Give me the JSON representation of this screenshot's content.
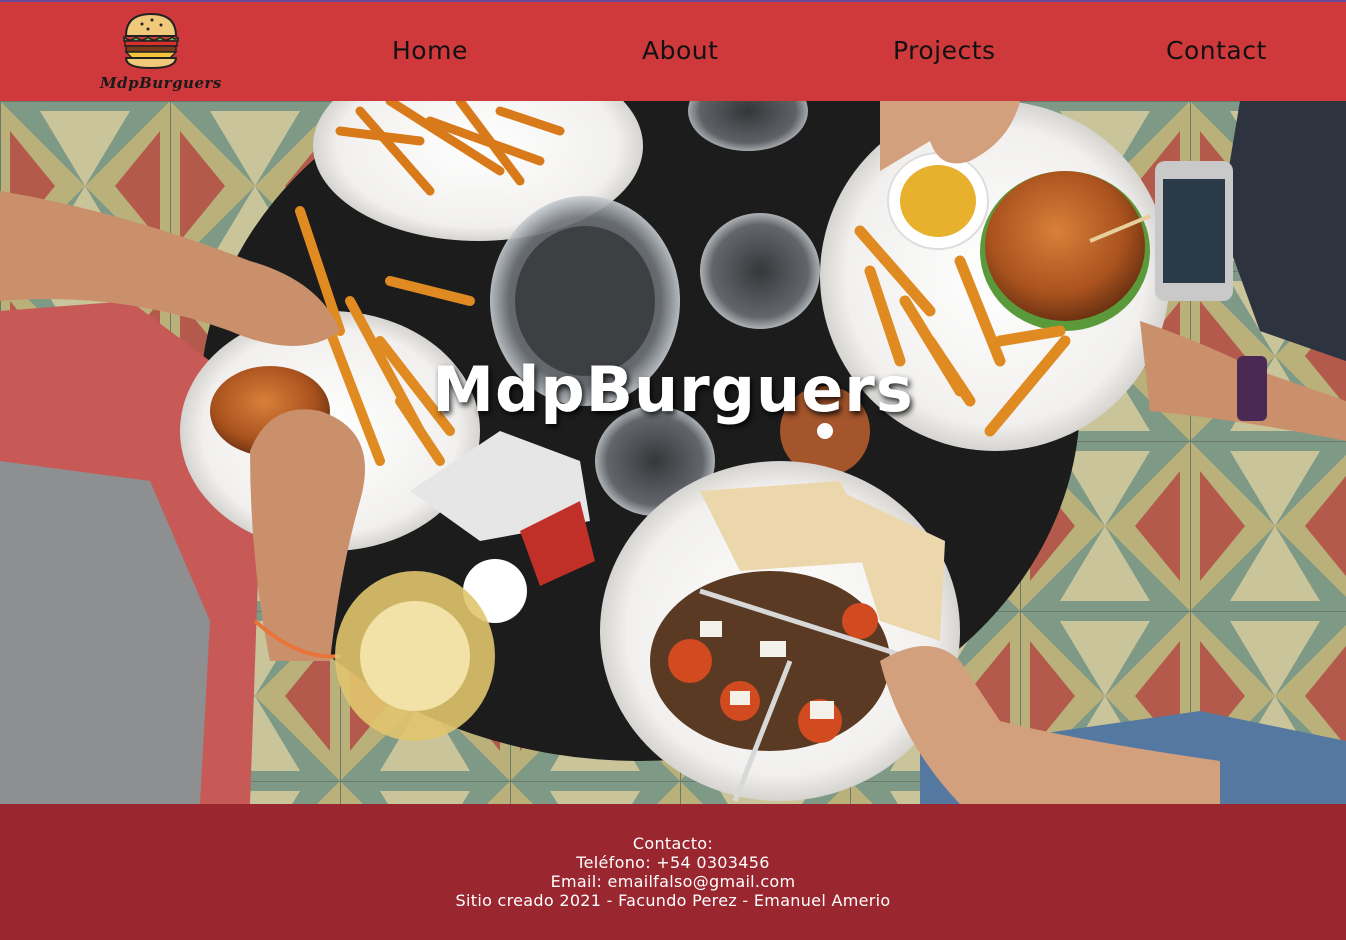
{
  "header": {
    "logo_text": "MdpBurguers",
    "logo_icon": "burger-icon",
    "nav": [
      {
        "label": "Home"
      },
      {
        "label": "About"
      },
      {
        "label": "Projects"
      },
      {
        "label": "Contact"
      }
    ]
  },
  "hero": {
    "title": "MdpBurguers",
    "image": "overhead-table-burgers-fries-photo"
  },
  "footer": {
    "contact_heading": "Contacto:",
    "phone": "Teléfono: +54 0303456",
    "email": "Email: emailfalso@gmail.com",
    "credits": "Sitio creado 2021 - Facundo Perez - Emanuel Amerio"
  },
  "colors": {
    "header_bg": "#d0393c",
    "footer_bg": "#9a2630",
    "nav_text": "#111111",
    "hero_title": "#ffffff"
  }
}
